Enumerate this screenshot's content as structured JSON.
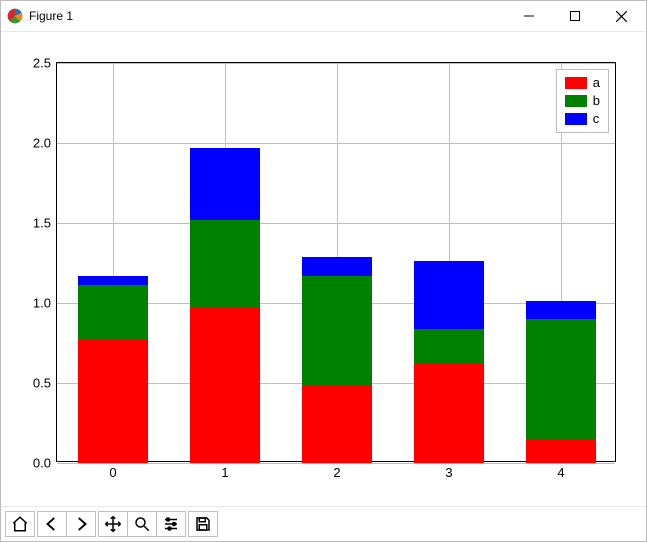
{
  "window": {
    "title": "Figure 1"
  },
  "toolbar_labels": {
    "home": "Home",
    "back": "Back",
    "forward": "Forward",
    "pan": "Pan",
    "zoom": "Zoom",
    "configure": "Configure subplots",
    "save": "Save"
  },
  "chart_data": {
    "type": "bar",
    "stacked": true,
    "categories": [
      "0",
      "1",
      "2",
      "3",
      "4"
    ],
    "series": [
      {
        "name": "a",
        "color": "#ff0000",
        "values": [
          0.77,
          0.97,
          0.48,
          0.62,
          0.15
        ]
      },
      {
        "name": "b",
        "color": "#008000",
        "values": [
          0.34,
          0.55,
          0.69,
          0.22,
          0.75
        ]
      },
      {
        "name": "c",
        "color": "#0000ff",
        "values": [
          0.06,
          0.45,
          0.12,
          0.42,
          0.11
        ]
      }
    ],
    "yticks": [
      "0.0",
      "0.5",
      "1.0",
      "1.5",
      "2.0",
      "2.5"
    ],
    "ylim": [
      0.0,
      2.5
    ],
    "grid": true,
    "legend_position": "upper right",
    "title": "",
    "xlabel": "",
    "ylabel": ""
  }
}
